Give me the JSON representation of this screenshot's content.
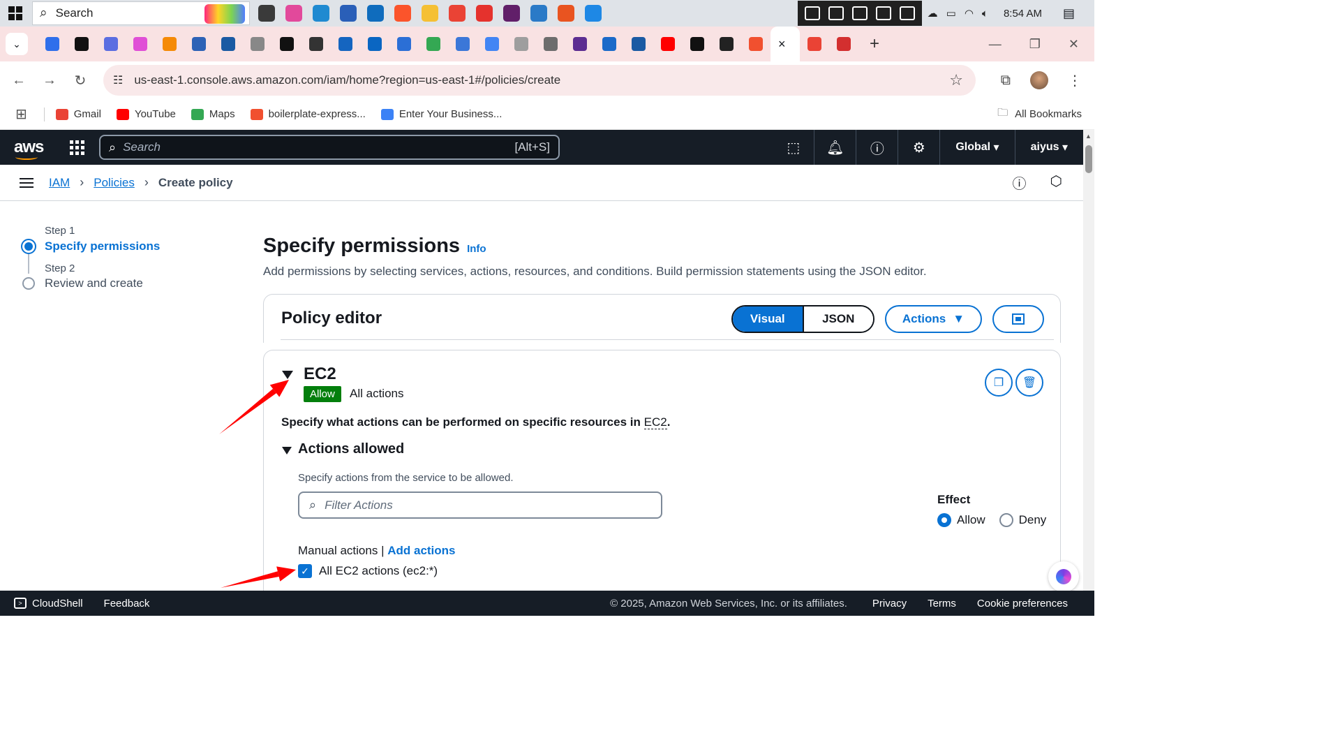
{
  "taskbar": {
    "search_label": "Search",
    "apps": [
      {
        "name": "task-view-icon",
        "color": "#3a3a3a"
      },
      {
        "name": "copilot-icon",
        "color": "#e2499b"
      },
      {
        "name": "edge-icon",
        "color": "#1f8ad1"
      },
      {
        "name": "store-icon",
        "color": "#2a5fb8"
      },
      {
        "name": "outlook-icon",
        "color": "#0f6cbd"
      },
      {
        "name": "brave-icon",
        "color": "#fb542b"
      },
      {
        "name": "file-explorer-icon",
        "color": "#f5c034"
      },
      {
        "name": "chrome-icon",
        "color": "#ea4335"
      },
      {
        "name": "wps-icon",
        "color": "#e5322d"
      },
      {
        "name": "slack-icon",
        "color": "#611f69"
      },
      {
        "name": "azure-data-studio-icon",
        "color": "#2a7ac7"
      },
      {
        "name": "ubuntu-icon",
        "color": "#e95420"
      },
      {
        "name": "vscode-icon",
        "color": "#1e88e5"
      }
    ],
    "clock": "8:54 AM"
  },
  "browser": {
    "url": "us-east-1.console.aws.amazon.com/iam/home?region=us-east-1#/policies/create",
    "tab_favicons": [
      "#2f6feb",
      "#111111",
      "#5b6ee1",
      "#e04fd6",
      "#f58a07",
      "#2d62b6",
      "#1a5aa3",
      "#888888",
      "#111111",
      "#333333",
      "#1565c0",
      "#0a66c2",
      "#2b6fd6",
      "#34a853",
      "#3b77d8",
      "#4285f4",
      "#9e9e9e",
      "#6d6d6d",
      "#5c2d91",
      "#1b6ac9",
      "#1a5aa3",
      "#ff0000",
      "#111111",
      "#222222",
      "#f1502f",
      "#ea4335",
      "#d32f2f"
    ],
    "active_tab_close": "×",
    "bookmarks": [
      {
        "label": "Gmail",
        "color": "#ea4335"
      },
      {
        "label": "YouTube",
        "color": "#ff0000"
      },
      {
        "label": "Maps",
        "color": "#34a853"
      },
      {
        "label": "boilerplate-express...",
        "color": "#f1502f"
      },
      {
        "label": "Enter Your Business...",
        "color": "#3b82f6"
      }
    ],
    "all_bookmarks": "All Bookmarks"
  },
  "aws": {
    "logo": "aws",
    "search_placeholder": "Search",
    "search_shortcut": "[Alt+S]",
    "region": "Global",
    "user": "aiyus"
  },
  "breadcrumb": {
    "iam": "IAM",
    "policies": "Policies",
    "current": "Create policy"
  },
  "wizard": {
    "step1_label": "Step 1",
    "step1_title": "Specify permissions",
    "step2_label": "Step 2",
    "step2_title": "Review and create"
  },
  "page": {
    "title": "Specify permissions",
    "info": "Info",
    "description": "Add permissions by selecting services, actions, resources, and conditions. Build permission statements using the JSON editor."
  },
  "editor": {
    "title": "Policy editor",
    "visual": "Visual",
    "json": "JSON",
    "actions": "Actions"
  },
  "statement": {
    "service": "EC2",
    "effect_badge": "Allow",
    "summary": "All actions",
    "spec_prefix": "Specify what actions can be performed on specific resources in ",
    "spec_service": "EC2",
    "spec_suffix": ".",
    "actions_allowed": "Actions allowed",
    "actions_hint": "Specify actions from the service to be allowed.",
    "filter_placeholder": "Filter Actions",
    "effect_label": "Effect",
    "effect_allow": "Allow",
    "effect_deny": "Deny",
    "manual_actions": "Manual actions",
    "add_actions": "Add actions",
    "all_actions_checkbox": "All EC2 actions (ec2:*)"
  },
  "footer": {
    "cloudshell": "CloudShell",
    "feedback": "Feedback",
    "copyright": "© 2025, Amazon Web Services, Inc. or its affiliates.",
    "privacy": "Privacy",
    "terms": "Terms",
    "cookies": "Cookie preferences"
  },
  "annotation_color": "#ff0000"
}
